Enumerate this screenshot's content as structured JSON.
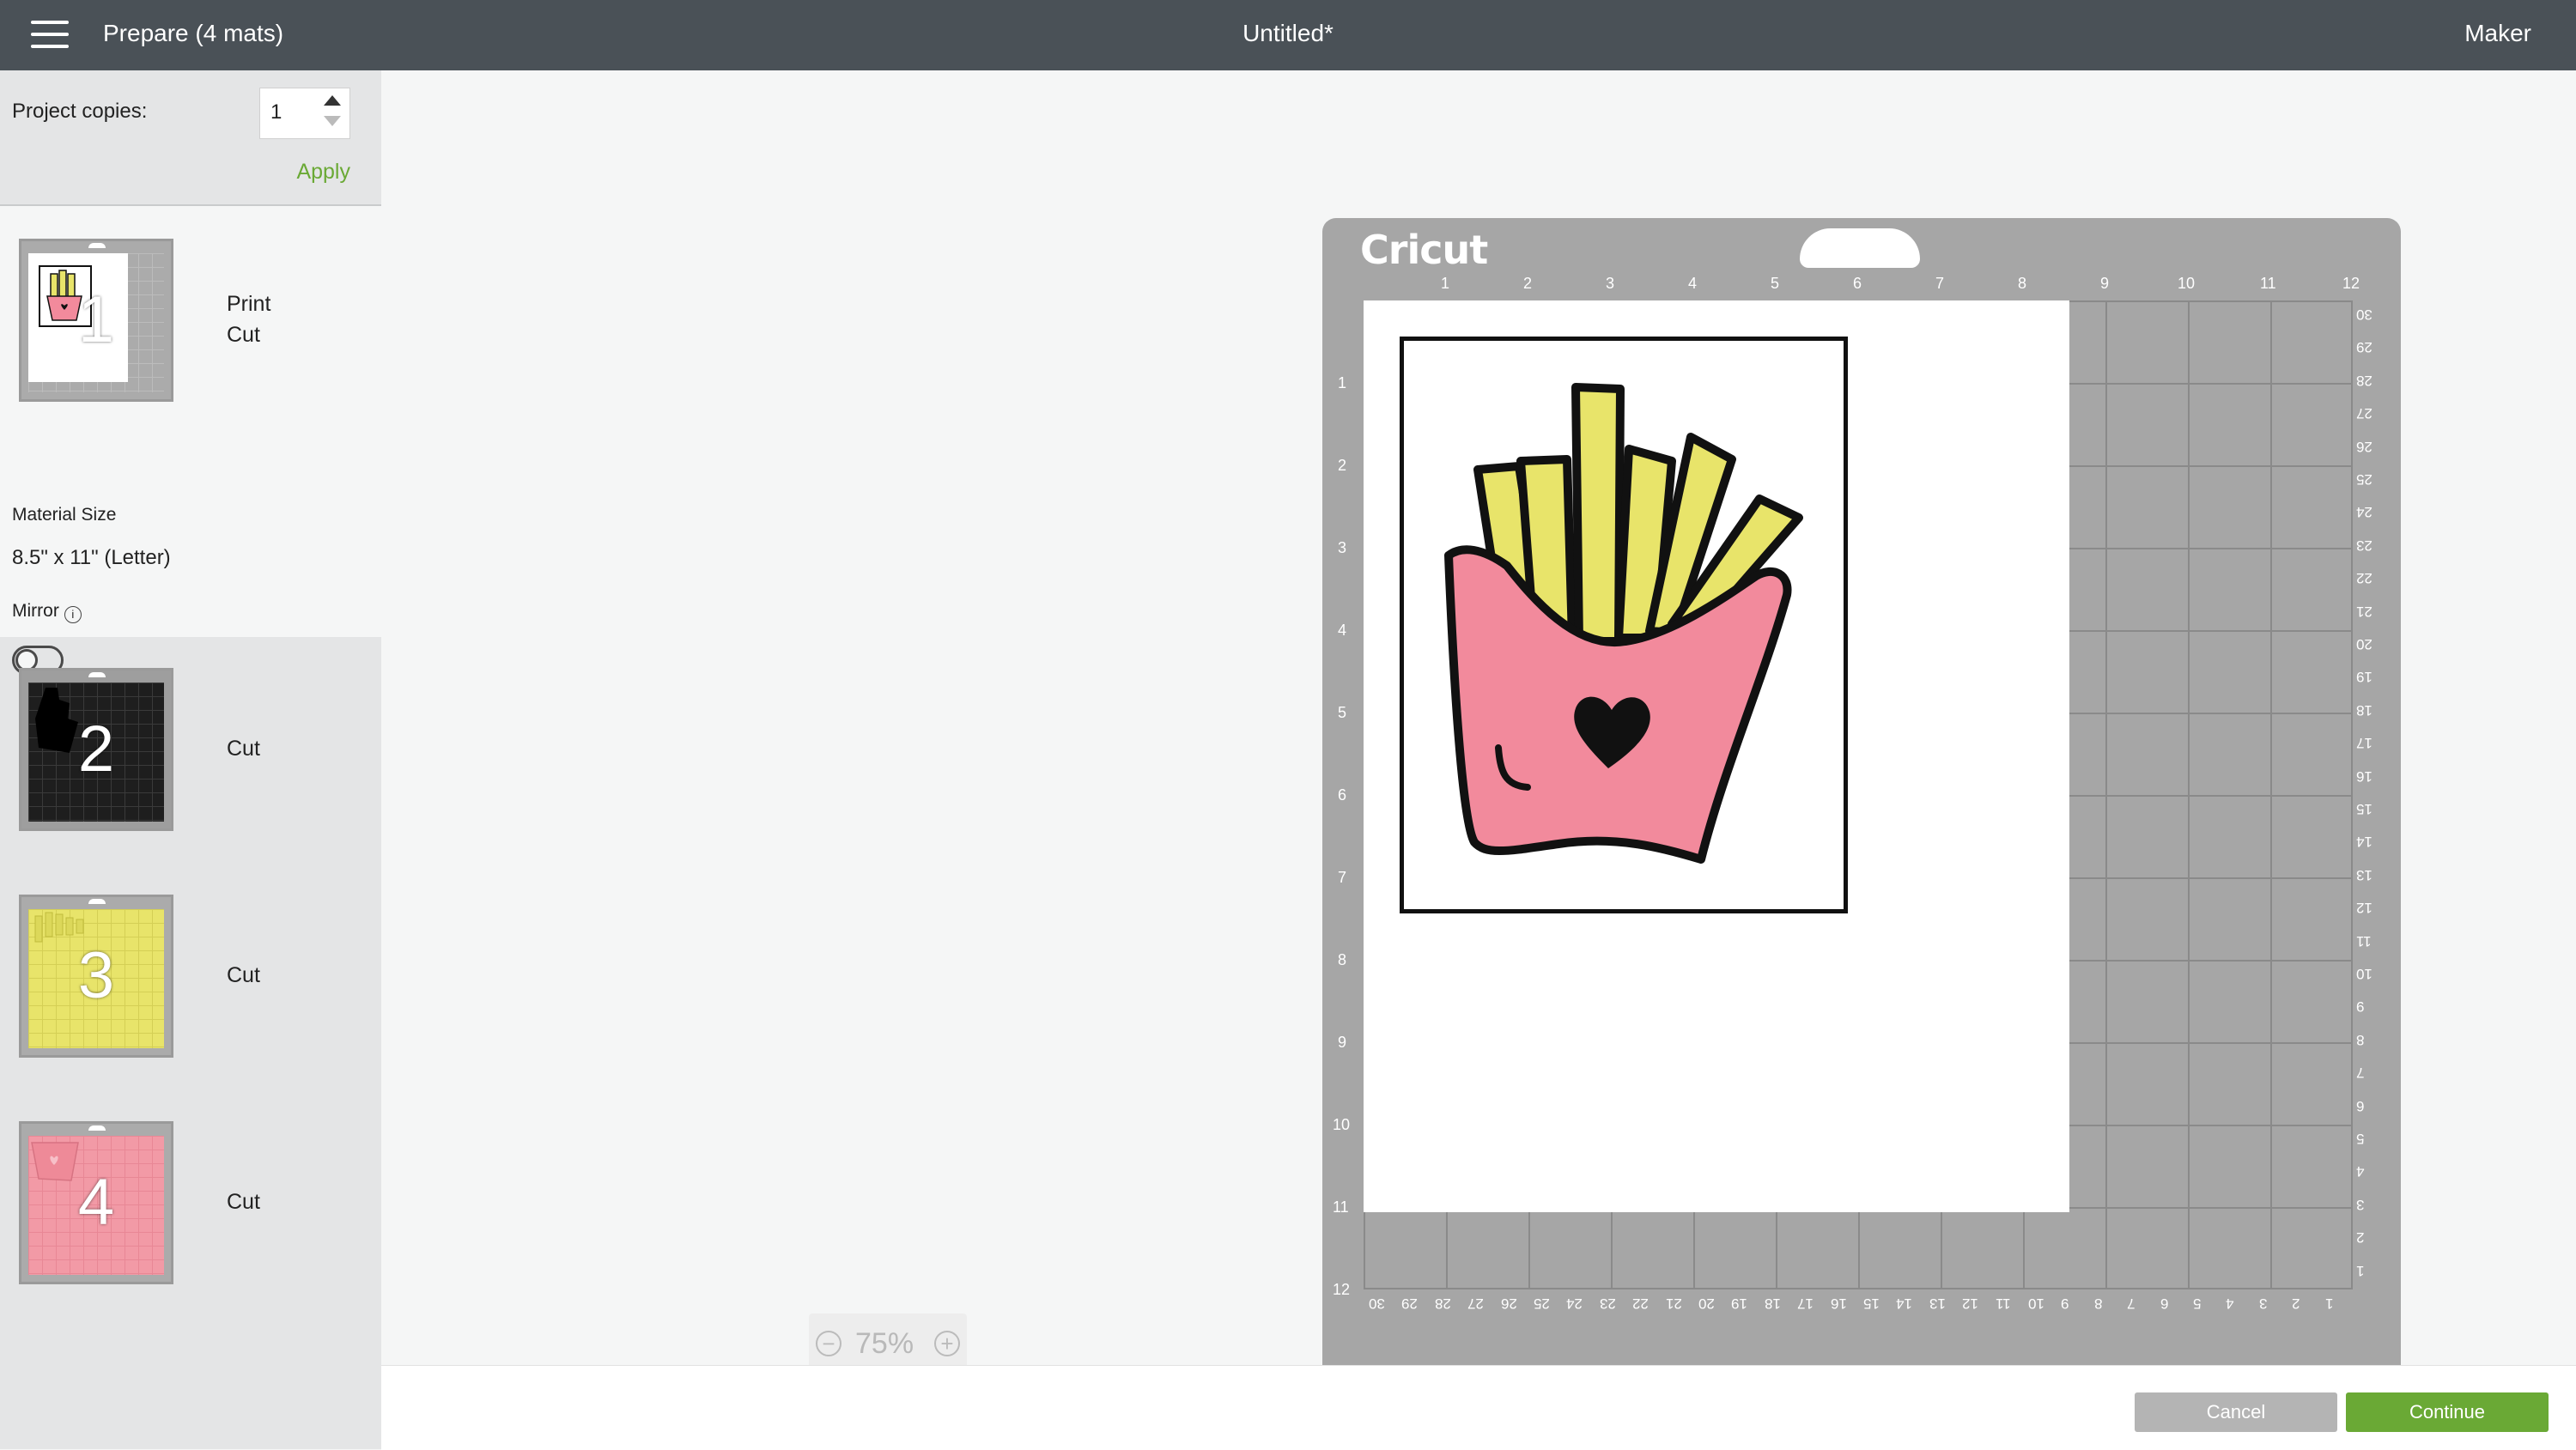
{
  "header": {
    "menu_icon": "hamburger-icon",
    "title": "Prepare (4 mats)",
    "document_title": "Untitled*",
    "machine": "Maker"
  },
  "copies": {
    "label": "Project copies:",
    "value": "1",
    "apply_label": "Apply"
  },
  "mats": [
    {
      "number": "1",
      "label_line1": "Print",
      "label_line2": "Cut",
      "color": "#ffffff"
    },
    {
      "number": "2",
      "label_line1": "Cut",
      "label_line2": "",
      "color": "#1e1e1e"
    },
    {
      "number": "3",
      "label_line1": "Cut",
      "label_line2": "",
      "color": "#e8e46a"
    },
    {
      "number": "4",
      "label_line1": "Cut",
      "label_line2": "",
      "color": "#f29aa6"
    }
  ],
  "material": {
    "title": "Material Size",
    "value": "8.5\" x 11\" (Letter)"
  },
  "mirror": {
    "label": "Mirror",
    "info_icon": "info-icon",
    "enabled": false
  },
  "mat_view": {
    "logo": "Cricut",
    "top_ruler": [
      "1",
      "2",
      "3",
      "4",
      "5",
      "6",
      "7",
      "8",
      "9",
      "10",
      "11",
      "12"
    ],
    "left_ruler": [
      "1",
      "2",
      "3",
      "4",
      "5",
      "6",
      "7",
      "8",
      "9",
      "10",
      "11",
      "12"
    ],
    "right_ruler": [
      "30",
      "29",
      "28",
      "27",
      "26",
      "25",
      "24",
      "23",
      "22",
      "21",
      "20",
      "19",
      "18",
      "17",
      "16",
      "15",
      "14",
      "13",
      "12",
      "11",
      "10",
      "9",
      "8",
      "7",
      "6",
      "5",
      "4",
      "3",
      "2",
      "1"
    ],
    "bottom_ruler": [
      "30",
      "29",
      "28",
      "27",
      "26",
      "25",
      "24",
      "23",
      "22",
      "21",
      "20",
      "19",
      "18",
      "17",
      "16",
      "15",
      "14",
      "13",
      "12",
      "11",
      "10",
      "9",
      "8",
      "7",
      "6",
      "5",
      "4",
      "3",
      "2",
      "1"
    ],
    "colors": {
      "fries": "#e8e46a",
      "carton": "#f28a9c",
      "outline": "#111111"
    }
  },
  "zoom": {
    "value": "75%",
    "minus_icon": "zoom-out-icon",
    "plus_icon": "zoom-in-icon"
  },
  "footer": {
    "cancel_label": "Cancel",
    "continue_label": "Continue"
  },
  "accent": "#6aa935"
}
